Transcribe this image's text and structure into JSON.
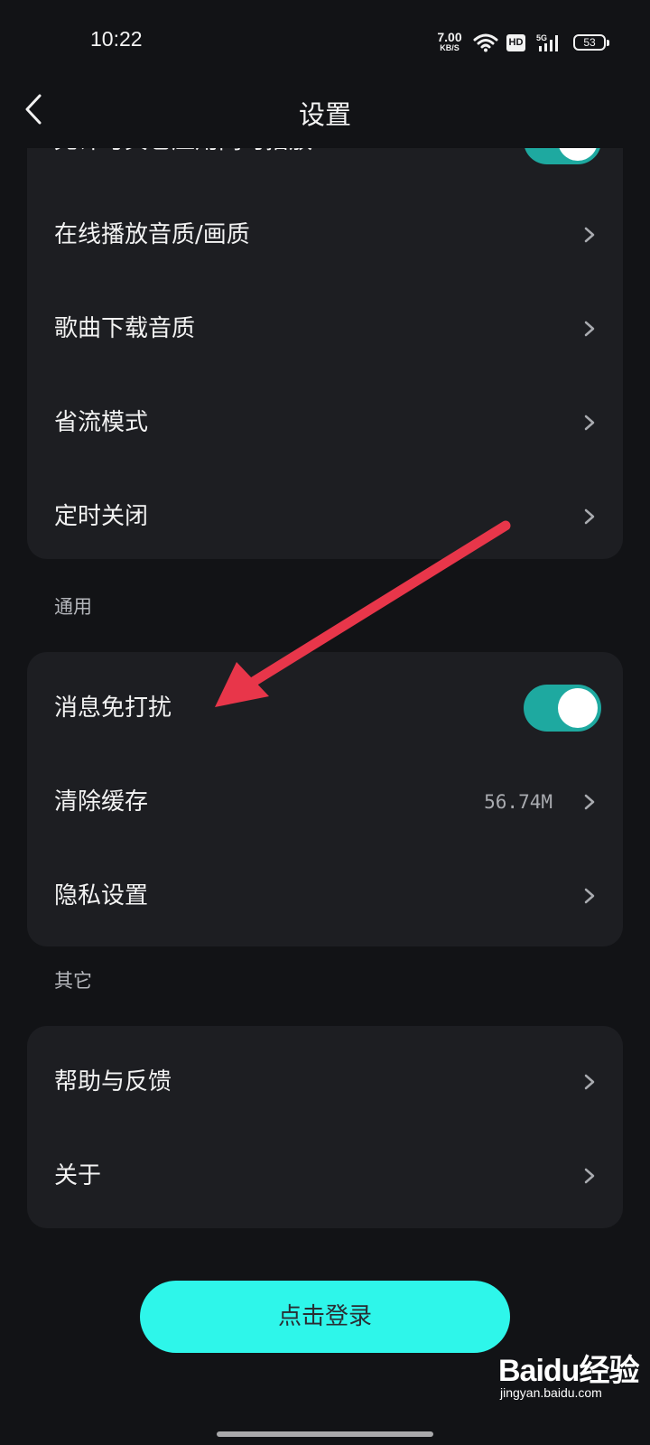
{
  "status_bar": {
    "time": "10:22",
    "net_speed_value": "7.00",
    "net_speed_unit": "KB/S",
    "hd_badge": "HD",
    "network_type": "5G",
    "battery_level": "53"
  },
  "header": {
    "title": "设置"
  },
  "playback_section": {
    "items": [
      {
        "label": "允许与其它应用同时播放",
        "type": "toggle",
        "on": true
      },
      {
        "label": "在线播放音质/画质",
        "type": "link"
      },
      {
        "label": "歌曲下载音质",
        "type": "link"
      },
      {
        "label": "省流模式",
        "type": "link"
      },
      {
        "label": "定时关闭",
        "type": "link"
      }
    ]
  },
  "general_section": {
    "label": "通用",
    "items": [
      {
        "label": "消息免打扰",
        "type": "toggle",
        "on": true
      },
      {
        "label": "清除缓存",
        "type": "link",
        "value": "56.74M"
      },
      {
        "label": "隐私设置",
        "type": "link"
      }
    ]
  },
  "other_section": {
    "label": "其它",
    "items": [
      {
        "label": "帮助与反馈",
        "type": "link"
      },
      {
        "label": "关于",
        "type": "link"
      }
    ]
  },
  "login_button": {
    "label": "点击登录"
  },
  "watermark": {
    "brand": "Baidu经验",
    "url": "jingyan.baidu.com"
  },
  "colors": {
    "background": "#121316",
    "card": "#1d1e22",
    "toggle_on": "#1ea9a0",
    "login_button": "#2ef6ea",
    "annotation_arrow": "#e8364a"
  }
}
